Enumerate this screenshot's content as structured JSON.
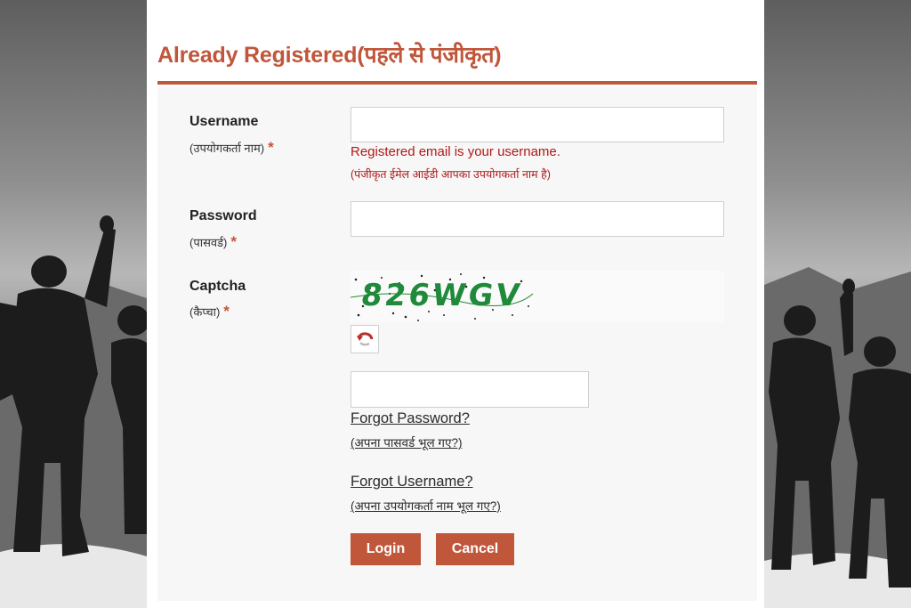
{
  "form": {
    "heading": "Already Registered(पहले से पंजीकृत)",
    "username": {
      "label": "Username",
      "sub_label": "(उपयोगकर्ता नाम)",
      "required_mark": "*",
      "value": "",
      "hint_en": "Registered email is your username.",
      "hint_hi": "(पंजीकृत ईमेल आईडी आपका उपयोगकर्ता नाम है)"
    },
    "password": {
      "label": "Password",
      "sub_label": "(पासवर्ड)",
      "required_mark": "*",
      "value": ""
    },
    "captcha": {
      "label": "Captcha",
      "sub_label": "(कैप्चा)",
      "required_mark": "*",
      "image_text": "826WGV",
      "value": ""
    },
    "forgot_password": "Forgot Password?",
    "forgot_password_hi": "(अपना पासवर्ड भूल गए?)",
    "forgot_username": "Forgot Username?",
    "forgot_username_hi": "(अपना उपयोगकर्ता नाम भूल गए?)",
    "login_button": "Login",
    "cancel_button": "Cancel"
  },
  "colors": {
    "accent": "#c0563a",
    "error_text": "#b01818",
    "captcha_text": "#1f8a3a"
  },
  "icons": {
    "captcha_refresh": "refresh-icon"
  }
}
